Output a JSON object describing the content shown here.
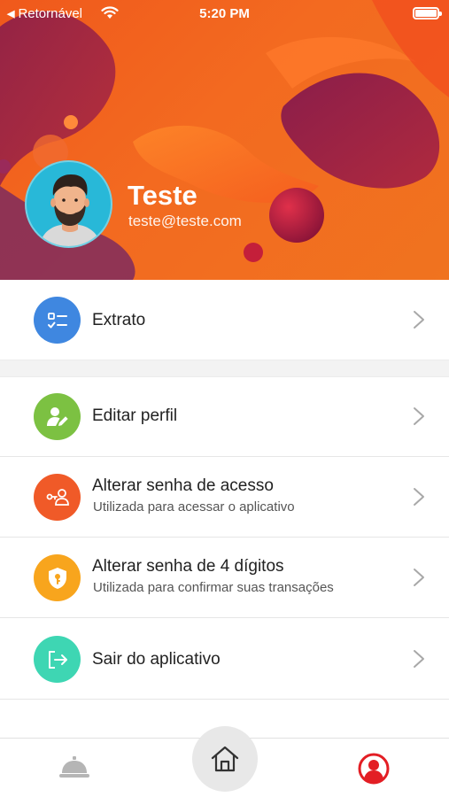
{
  "status_bar": {
    "back_label": "Retornável",
    "time": "5:20 PM",
    "icons": [
      "back-arrow-icon",
      "wifi-icon",
      "battery-icon"
    ]
  },
  "profile": {
    "name": "Teste",
    "email": "teste@teste.com"
  },
  "menu": {
    "statement": {
      "title": "Extrato",
      "icon": "checklist-icon",
      "color": "#3f87e0"
    },
    "edit_profile": {
      "title": "Editar perfil",
      "icon": "user-edit-icon",
      "color": "#7cc142"
    },
    "change_password": {
      "title": "Alterar senha de acesso",
      "subtitle": "Utilizada para acessar o aplicativo",
      "icon": "user-key-icon",
      "color": "#f05a28"
    },
    "change_pin": {
      "title": "Alterar senha de 4 dígitos",
      "subtitle": "Utilizada para confirmar suas transações",
      "icon": "shield-key-icon",
      "color": "#f8a51d"
    },
    "logout": {
      "title": "Sair do aplicativo",
      "icon": "logout-icon",
      "color": "#3ed6b3"
    }
  },
  "bottom_nav": {
    "items": [
      "service-bell-icon",
      "home-icon",
      "user-profile-icon"
    ],
    "accent": "#e31e24"
  }
}
